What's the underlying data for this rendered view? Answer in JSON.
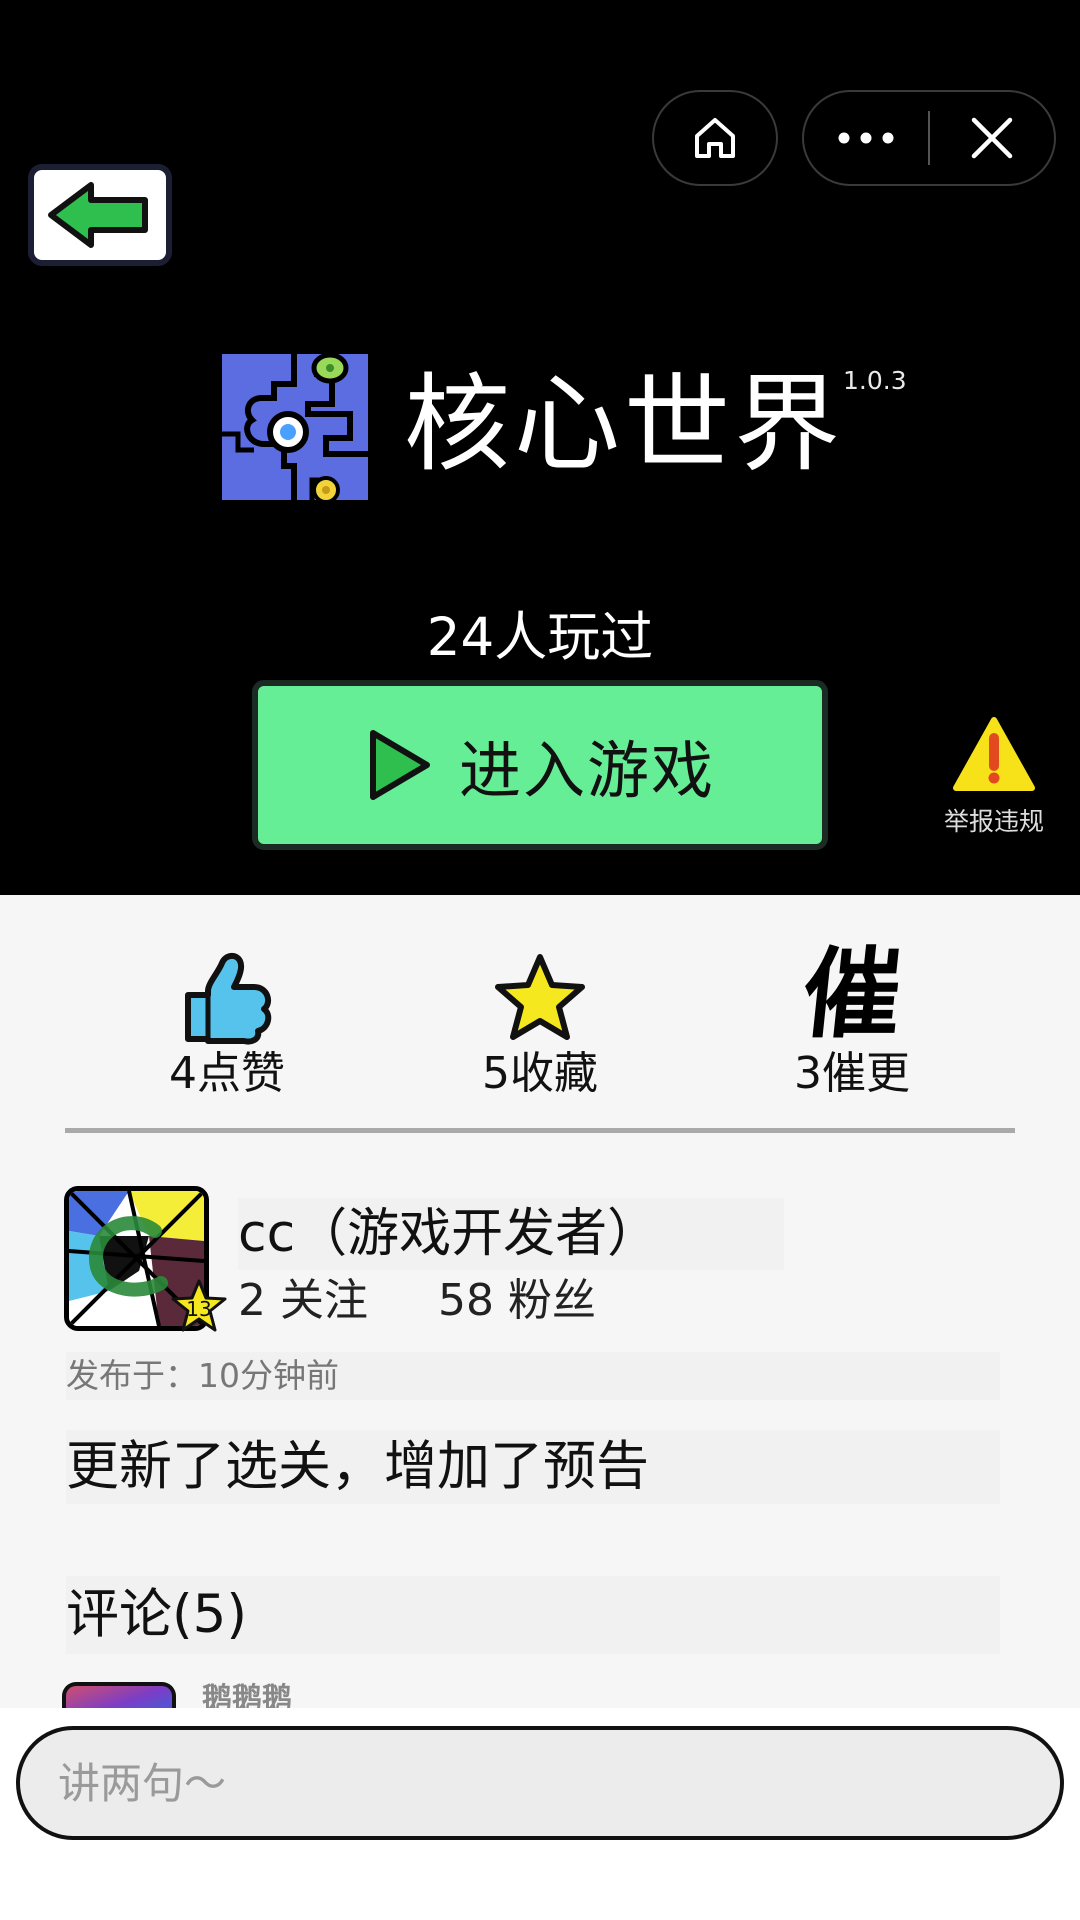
{
  "window": {
    "home_icon": "home-icon",
    "more_icon": "more-dots-icon",
    "close_icon": "close-icon"
  },
  "nav": {
    "back_icon": "green-left-arrow-icon"
  },
  "game": {
    "title": "核心世界",
    "version": "1.0.3",
    "played": "24人玩过",
    "enter_label": "进入游戏",
    "report_label": "举报违规",
    "accent": "#66ee96"
  },
  "stats": {
    "likes": "4点赞",
    "favorites": "5收藏",
    "urge_glyph": "催",
    "urges": "3催更"
  },
  "author": {
    "name": "cc（游戏开发者）",
    "level": "13",
    "following": "2 关注",
    "followers": "58 粉丝",
    "published": "发布于：10分钟前"
  },
  "post": {
    "description": "更新了选关，增加了预告"
  },
  "comments": {
    "title": "评论(5)",
    "first_user": "鹅鹅鹅"
  },
  "input": {
    "placeholder": "讲两句～"
  }
}
